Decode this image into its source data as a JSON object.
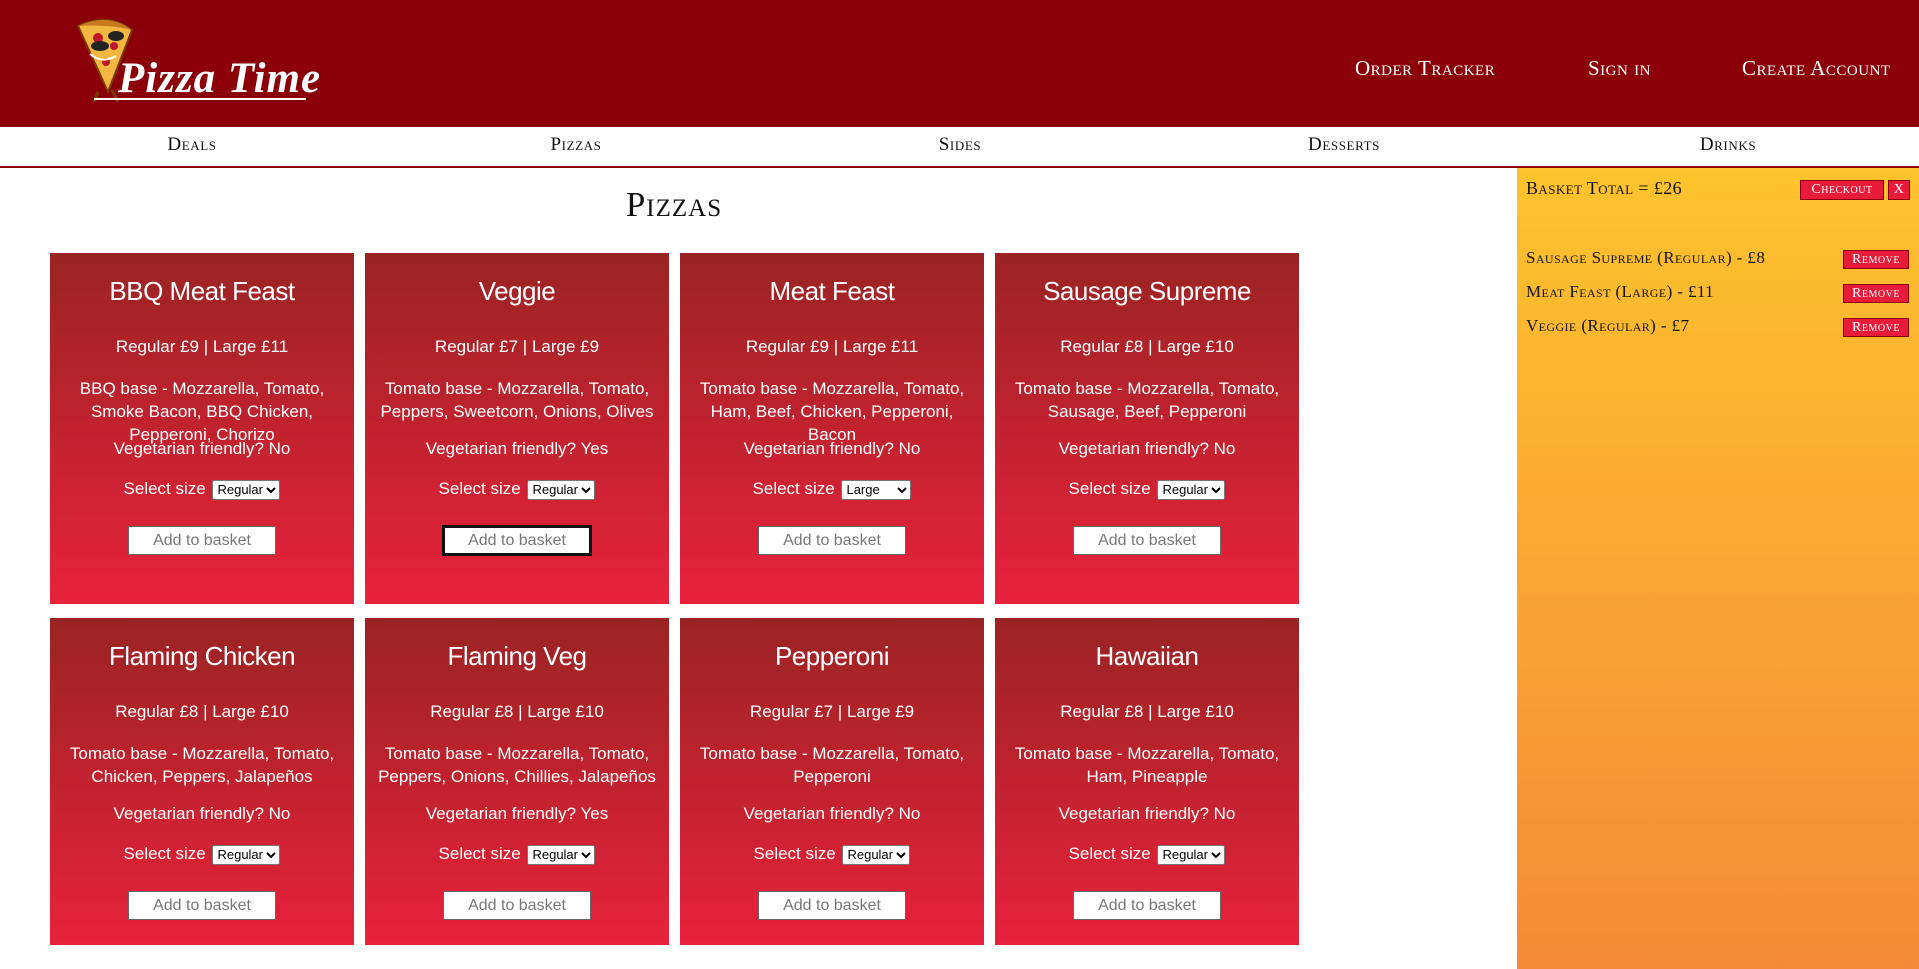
{
  "brand": {
    "name": "Pizza Time"
  },
  "header": {
    "links": [
      {
        "label": "Order Tracker"
      },
      {
        "label": "Sign in"
      },
      {
        "label": "Create Account"
      }
    ]
  },
  "nav": {
    "items": [
      "Deals",
      "Pizzas",
      "Sides",
      "Desserts",
      "Drinks"
    ]
  },
  "page": {
    "title": "Pizzas"
  },
  "size_label": "Select size",
  "add_label": "Add to basket",
  "size_options": [
    "Regular",
    "Large"
  ],
  "pizzas": [
    {
      "name": "BBQ Meat Feast",
      "price": "Regular £9 | Large £11",
      "desc": "BBQ base - Mozzarella, Tomato, Smoke Bacon, BBQ Chicken, Pepperoni, Chorizo",
      "veg": "Vegetarian friendly? No",
      "size": "Regular"
    },
    {
      "name": "Veggie",
      "price": "Regular £7 | Large £9",
      "desc": "Tomato base - Mozzarella, Tomato, Peppers, Sweetcorn, Onions, Olives",
      "veg": "Vegetarian friendly? Yes",
      "size": "Regular"
    },
    {
      "name": "Meat Feast",
      "price": "Regular £9 | Large £11",
      "desc": "Tomato base - Mozzarella, Tomato, Ham, Beef, Chicken, Pepperoni, Bacon",
      "veg": "Vegetarian friendly? No",
      "size": "Large"
    },
    {
      "name": "Sausage Supreme",
      "price": "Regular £8 | Large £10",
      "desc": "Tomato base - Mozzarella, Tomato, Sausage, Beef, Pepperoni",
      "veg": "Vegetarian friendly? No",
      "size": "Regular"
    },
    {
      "name": "Flaming Chicken",
      "price": "Regular £8 | Large £10",
      "desc": "Tomato base - Mozzarella, Tomato, Chicken, Peppers, Jalapeños",
      "veg": "Vegetarian friendly? No",
      "size": "Regular"
    },
    {
      "name": "Flaming Veg",
      "price": "Regular £8 | Large £10",
      "desc": "Tomato base - Mozzarella, Tomato, Peppers, Onions, Chillies, Jalapeños",
      "veg": "Vegetarian friendly? Yes",
      "size": "Regular"
    },
    {
      "name": "Pepperoni",
      "price": "Regular £7 | Large £9",
      "desc": "Tomato base - Mozzarella, Tomato, Pepperoni",
      "veg": "Vegetarian friendly? No",
      "size": "Regular"
    },
    {
      "name": "Hawaiian",
      "price": "Regular £8 | Large £10",
      "desc": "Tomato base - Mozzarella, Tomato, Ham, Pineapple",
      "veg": "Vegetarian friendly? No",
      "size": "Regular"
    }
  ],
  "basket": {
    "total": "Basket Total = £26",
    "checkout_label": "Checkout",
    "close_label": "X",
    "remove_label": "Remove",
    "items": [
      "Sausage Supreme (Regular) - £8",
      "Meat Feast (Large) - £11",
      "Veggie (Regular) - £7"
    ]
  },
  "colors": {
    "header_bg": "#8b0008",
    "card_top": "#9a2323",
    "card_bottom": "#e8223a",
    "basket_top": "#fec32d",
    "basket_bottom": "#f48a37",
    "button_red": "#e81b3b"
  }
}
